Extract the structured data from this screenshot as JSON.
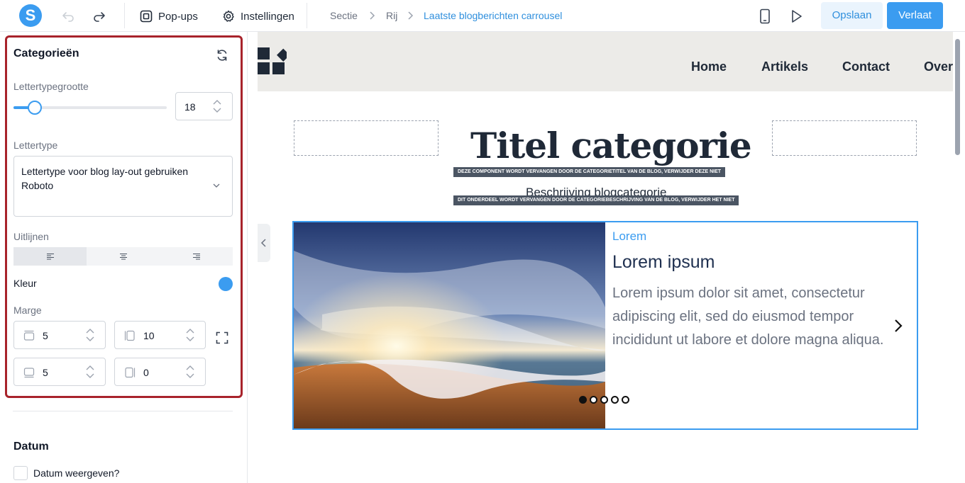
{
  "topbar": {
    "logo_letter": "S",
    "popups_label": "Pop-ups",
    "settings_label": "Instellingen",
    "breadcrumb": [
      "Sectie",
      "Rij",
      "Laatste blogberichten carrousel"
    ],
    "save_label": "Opslaan",
    "leave_label": "Verlaat"
  },
  "sidebar": {
    "panel_title": "Categorieën",
    "font_size_label": "Lettertypegrootte",
    "font_size_value": "18",
    "font_size_fraction": 0.14,
    "font_label": "Lettertype",
    "font_select_line1": "Lettertype voor blog lay-out gebruiken",
    "font_select_line2": "Roboto",
    "align_label": "Uitlijnen",
    "align_selected": "left",
    "color_label": "Kleur",
    "color_value": "#3b9cf0",
    "margin_label": "Marge",
    "margin_top": "5",
    "margin_left": "10",
    "margin_bottom": "5",
    "margin_right": "0",
    "date_section_title": "Datum",
    "show_date_label": "Datum weergeven?"
  },
  "canvas": {
    "nav_links": [
      "Home",
      "Artikels",
      "Contact",
      "Over"
    ],
    "title": "Titel categorie",
    "title_note": "DEZE COMPONENT WORDT VERVANGEN DOOR DE CATEGORIETITEL VAN DE BLOG, VERWIJDER DEZE NIET",
    "description": "Beschrijving blogcategorie",
    "description_note": "DIT ONDERDEEL WORDT VERVANGEN DOOR DE CATEGORIEBESCHRIJVING VAN DE BLOG, VERWIJDER HET NIET",
    "card": {
      "category": "Lorem",
      "title": "Lorem ipsum",
      "body": "Lorem ipsum dolor sit amet, consectetur adipiscing elit, sed do eiusmod tempor incididunt ut labore et dolore magna aliqua."
    },
    "dots_count": 5,
    "active_dot": 1
  },
  "colors": {
    "accent": "#3b9cf0",
    "panel_border": "#a8232b",
    "navbar_bg": "#ecebe8"
  }
}
